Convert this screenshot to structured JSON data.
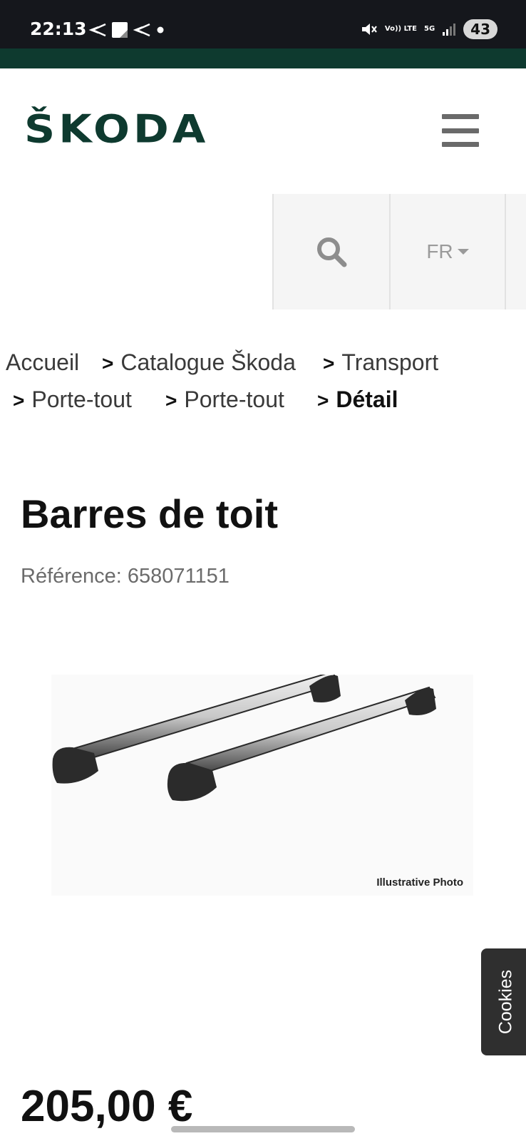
{
  "status_bar": {
    "time": "22:13",
    "volte_label": "Vo)) LTE",
    "network_label": "5G",
    "battery": "43"
  },
  "header": {
    "logo_text": "ŠKODA",
    "brand_color": "#0e3a2f"
  },
  "tools": {
    "language": "FR"
  },
  "breadcrumb": {
    "items": [
      "Accueil",
      "Catalogue Škoda",
      "Transport",
      "Porte-tout",
      "Porte-tout"
    ],
    "current": "Détail",
    "separator": ">"
  },
  "product": {
    "title": "Barres de toit",
    "reference_label": "Référence:",
    "reference": "658071151",
    "image_caption": "Illustrative Photo",
    "price": "205,00 €"
  },
  "cookies": {
    "label": "Cookies"
  }
}
